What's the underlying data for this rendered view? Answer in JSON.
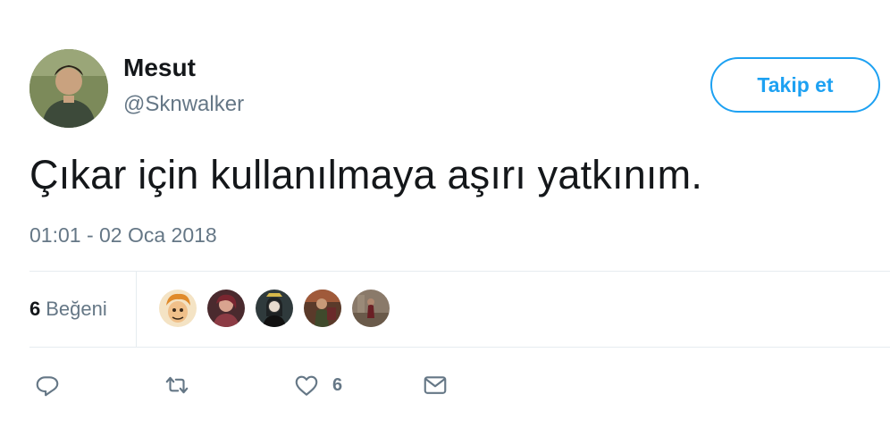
{
  "author": {
    "name": "Mesut",
    "handle": "@Sknwalker"
  },
  "follow_button": {
    "label": "Takip et"
  },
  "tweet": {
    "text": "Çıkar için kullanılmaya aşırı yatkınım.",
    "timestamp": "01:01 - 02 Oca 2018"
  },
  "stats": {
    "likes_count": "6",
    "likes_label": "Beğeni"
  },
  "likers": [
    {
      "icon": "cartoon-avatar"
    },
    {
      "icon": "user-avatar"
    },
    {
      "icon": "user-avatar"
    },
    {
      "icon": "user-avatar"
    },
    {
      "icon": "user-avatar"
    }
  ],
  "actions": {
    "reply_icon": "reply-icon",
    "retweet_icon": "retweet-icon",
    "like_icon": "heart-icon",
    "like_count": "6",
    "dm_icon": "envelope-icon"
  },
  "colors": {
    "accent": "#1da1f2",
    "muted_text": "#657786",
    "text": "#14171a",
    "divider": "#e6ecf0"
  }
}
